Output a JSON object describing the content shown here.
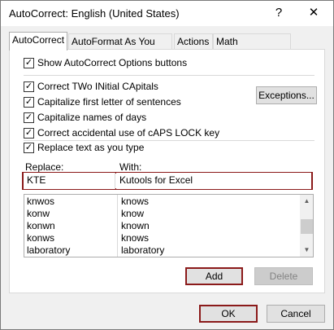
{
  "window": {
    "title": "AutoCorrect: English (United States)",
    "help_glyph": "?",
    "close_glyph": "✕"
  },
  "tabs": [
    {
      "label": "AutoCorrect",
      "active": true
    },
    {
      "label": "AutoFormat As You Type",
      "active": false
    },
    {
      "label": "Actions",
      "active": false
    },
    {
      "label": "Math AutoCorrect",
      "active": false
    }
  ],
  "options": {
    "show_buttons": {
      "label": "Show AutoCorrect Options buttons",
      "checked": true
    },
    "correct_two_initial": {
      "label": "Correct TWo INitial CApitals",
      "checked": true
    },
    "capitalize_first": {
      "label": "Capitalize first letter of sentences",
      "checked": true
    },
    "capitalize_days": {
      "label": "Capitalize names of days",
      "checked": true
    },
    "caps_lock": {
      "label": "Correct accidental use of cAPS LOCK key",
      "checked": true
    },
    "replace_text": {
      "label": "Replace text as you type",
      "checked": true
    }
  },
  "check_glyph": "✓",
  "exceptions_label": "Exceptions...",
  "replace": {
    "replace_label": "Replace:",
    "with_label": "With:",
    "replace_value": "KTE",
    "with_value": "Kutools for Excel"
  },
  "list": [
    {
      "replace": "knwos",
      "with": "knows"
    },
    {
      "replace": "konw",
      "with": "know"
    },
    {
      "replace": "konwn",
      "with": "known"
    },
    {
      "replace": "konws",
      "with": "knows"
    },
    {
      "replace": "laboratory",
      "with": "laboratory"
    }
  ],
  "scroll_up_glyph": "▲",
  "scroll_down_glyph": "▼",
  "buttons": {
    "add": "Add",
    "delete": "Delete",
    "ok": "OK",
    "cancel": "Cancel"
  },
  "colors": {
    "highlight": "#8b1a1a",
    "panel_bg": "#ffffff",
    "dialog_bg": "#f0f0f0"
  }
}
